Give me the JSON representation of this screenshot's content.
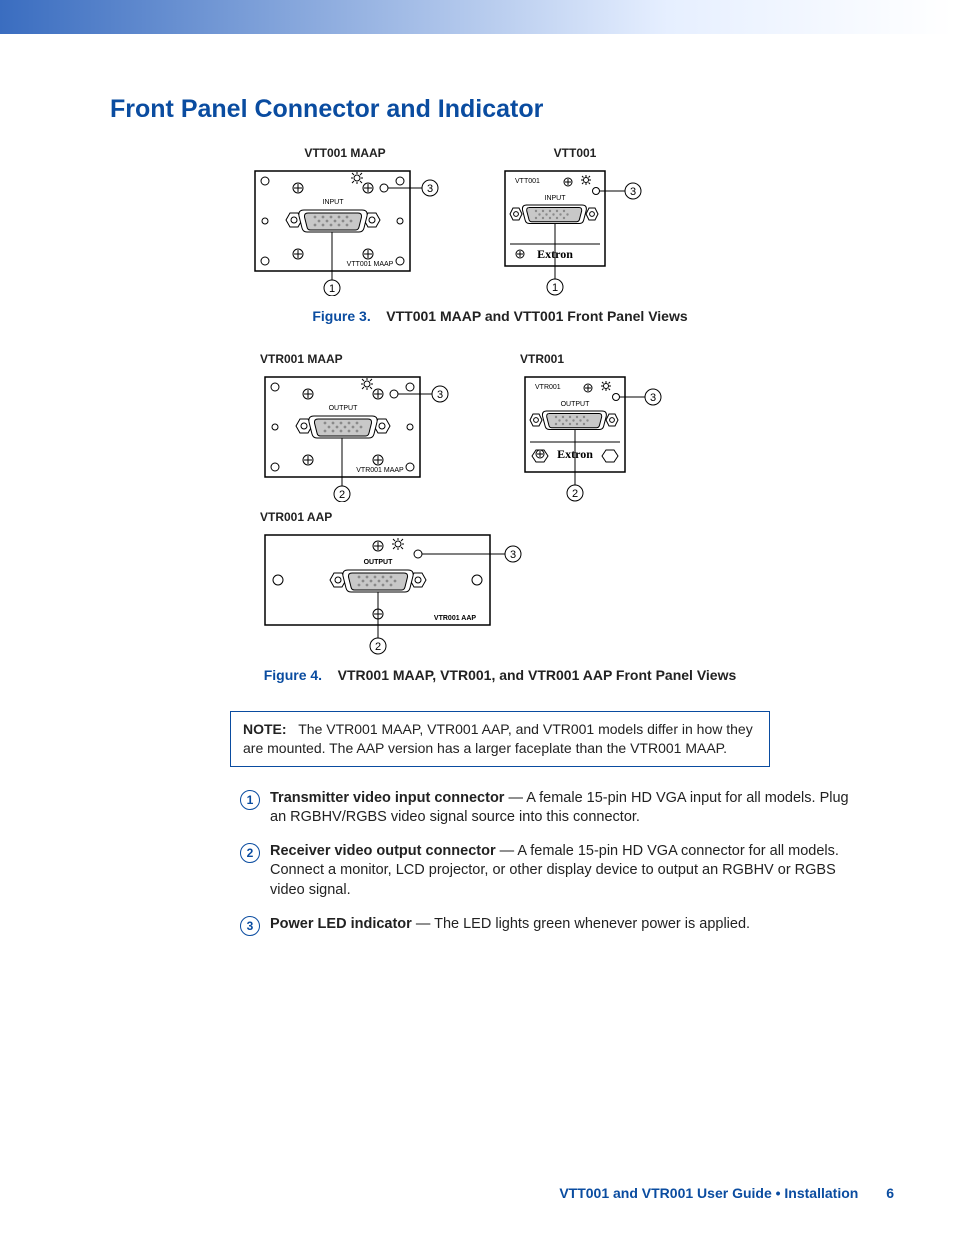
{
  "heading": "Front Panel Connector and Indicator",
  "fig3_label_a": "VTT001 MAAP",
  "fig3_label_b": "VTT001",
  "fig3_caption_num": "Figure 3.",
  "fig3_caption_txt": "VTT001 MAAP and VTT001 Front Panel Views",
  "fig4_label_a": "VTR001 MAAP",
  "fig4_label_b": "VTR001",
  "fig4_label_c": "VTR001 AAP",
  "fig4_caption_num": "Figure 4.",
  "fig4_caption_txt": "VTR001 MAAP, VTR001, and VTR001 AAP Front Panel Views",
  "note_label": "NOTE:",
  "note_text": "The VTR001 MAAP, VTR001 AAP, and VTR001 models differ in how they are mounted. The AAP version has a larger faceplate than the VTR001 MAAP.",
  "callouts": {
    "c1": {
      "num": "1",
      "lead": "Transmitter video input connector",
      "text": " — A female 15-pin HD VGA input for all models. Plug an RGBHV/RGBS video signal source into this connector."
    },
    "c2": {
      "num": "2",
      "lead": "Receiver video output connector",
      "text": " — A female 15-pin HD VGA connector for all models. Connect a monitor, LCD projector, or other display device to output an RGBHV or RGBS video signal."
    },
    "c3": {
      "num": "3",
      "lead": "Power LED indicator",
      "text": " — The LED lights green whenever power is applied."
    }
  },
  "diagram_text": {
    "input": "INPUT",
    "output": "OUTPUT",
    "vtt001": "VTT001",
    "vtt001_maap": "VTT001 MAAP",
    "vtr001": "VTR001",
    "vtr001_maap": "VTR001 MAAP",
    "vtr001_aap": "VTR001 AAP",
    "brand": "Extron"
  },
  "footer_text": "VTT001 and VTR001 User Guide • Installation",
  "page_number": "6"
}
